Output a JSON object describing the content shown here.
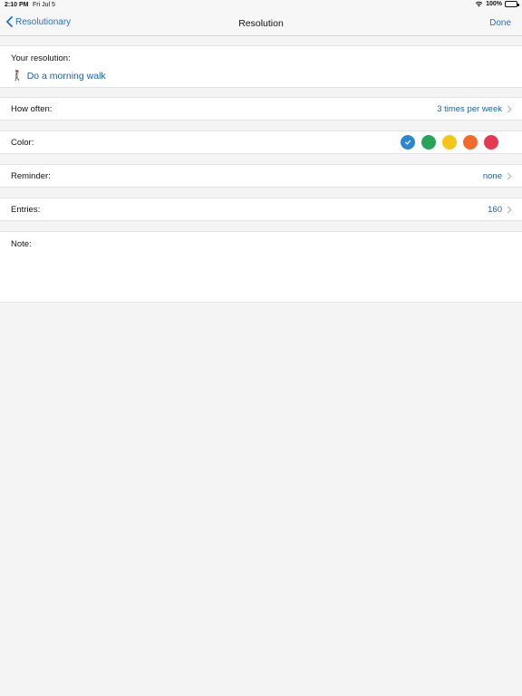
{
  "status_bar": {
    "time": "2:10 PM",
    "date": "Fri Jul 5",
    "battery": "100%",
    "wifi_icon": "wifi-icon",
    "battery_icon": "battery-icon"
  },
  "nav": {
    "back_label": "Resolutionary",
    "title": "Resolution",
    "done_label": "Done",
    "back_icon": "chevron-left-icon"
  },
  "resolution": {
    "label": "Your resolution:",
    "icon": "🚶‍♀️",
    "text": "Do a morning walk"
  },
  "how_often": {
    "label": "How often:",
    "value": "3 times per week"
  },
  "color": {
    "label": "Color:",
    "options": [
      {
        "name": "blue",
        "hex": "#2f86cf",
        "selected": true
      },
      {
        "name": "green",
        "hex": "#27a35a",
        "selected": false
      },
      {
        "name": "yellow",
        "hex": "#f5c518",
        "selected": false
      },
      {
        "name": "orange",
        "hex": "#f26b2a",
        "selected": false
      },
      {
        "name": "red",
        "hex": "#e8384f",
        "selected": false
      }
    ]
  },
  "reminder": {
    "label": "Reminder:",
    "value": "none"
  },
  "entries": {
    "label": "Entries:",
    "value": "160"
  },
  "note": {
    "label": "Note:",
    "value": ""
  },
  "accent": "#1f6fd1"
}
